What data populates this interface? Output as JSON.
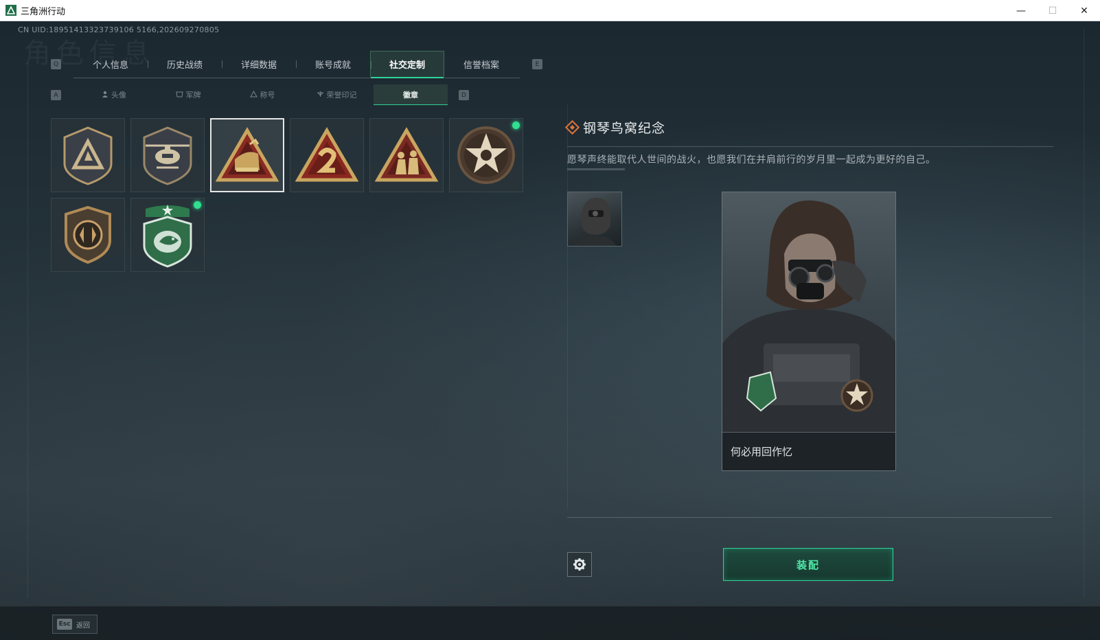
{
  "window": {
    "title": "三角洲行动",
    "min_icon": "—",
    "max_icon": "☐",
    "close_icon": "✕"
  },
  "uid_text": "CN UID:18951413323739106 5166,202609270805",
  "watermark": "角色信息",
  "main_tabs": {
    "left_key": "Q",
    "right_key": "E",
    "items": [
      {
        "label": "个人信息"
      },
      {
        "label": "历史战绩"
      },
      {
        "label": "详细数据"
      },
      {
        "label": "账号成就"
      },
      {
        "label": "社交定制",
        "active": true
      },
      {
        "label": "信誉档案"
      }
    ]
  },
  "sub_tabs": {
    "left_key": "A",
    "right_key": "D",
    "items": [
      {
        "label": "头像",
        "icon": "person-icon"
      },
      {
        "label": "军牌",
        "icon": "dogtag-icon"
      },
      {
        "label": "称号",
        "icon": "title-icon"
      },
      {
        "label": "荣誉印记",
        "icon": "honor-icon"
      },
      {
        "label": "徽章",
        "active": true
      }
    ]
  },
  "badges": [
    {
      "name": "triangle-shield-badge",
      "new": false,
      "selected": false
    },
    {
      "name": "helicopter-badge",
      "new": false,
      "selected": false
    },
    {
      "name": "piano-badge",
      "new": false,
      "selected": true
    },
    {
      "name": "number-two-badge",
      "new": false,
      "selected": false
    },
    {
      "name": "soldiers-badge",
      "new": false,
      "selected": false
    },
    {
      "name": "skull-star-badge",
      "new": true,
      "selected": false
    },
    {
      "name": "bronze-crest-badge",
      "new": false,
      "selected": false
    },
    {
      "name": "green-fish-badge",
      "new": true,
      "selected": false
    }
  ],
  "detail": {
    "title": "钢琴鸟窝纪念",
    "description": "愿琴声终能取代人世间的战火，也愿我们在并肩前行的岁月里一起成为更好的自己。",
    "card_caption": "何必用回作忆"
  },
  "actions": {
    "equip_label": "装配",
    "back_key": "Esc",
    "back_label": "返回"
  },
  "colors": {
    "accent": "#2fd49a",
    "title_diamond": "#e0733a",
    "new_dot": "#2fe08f"
  }
}
